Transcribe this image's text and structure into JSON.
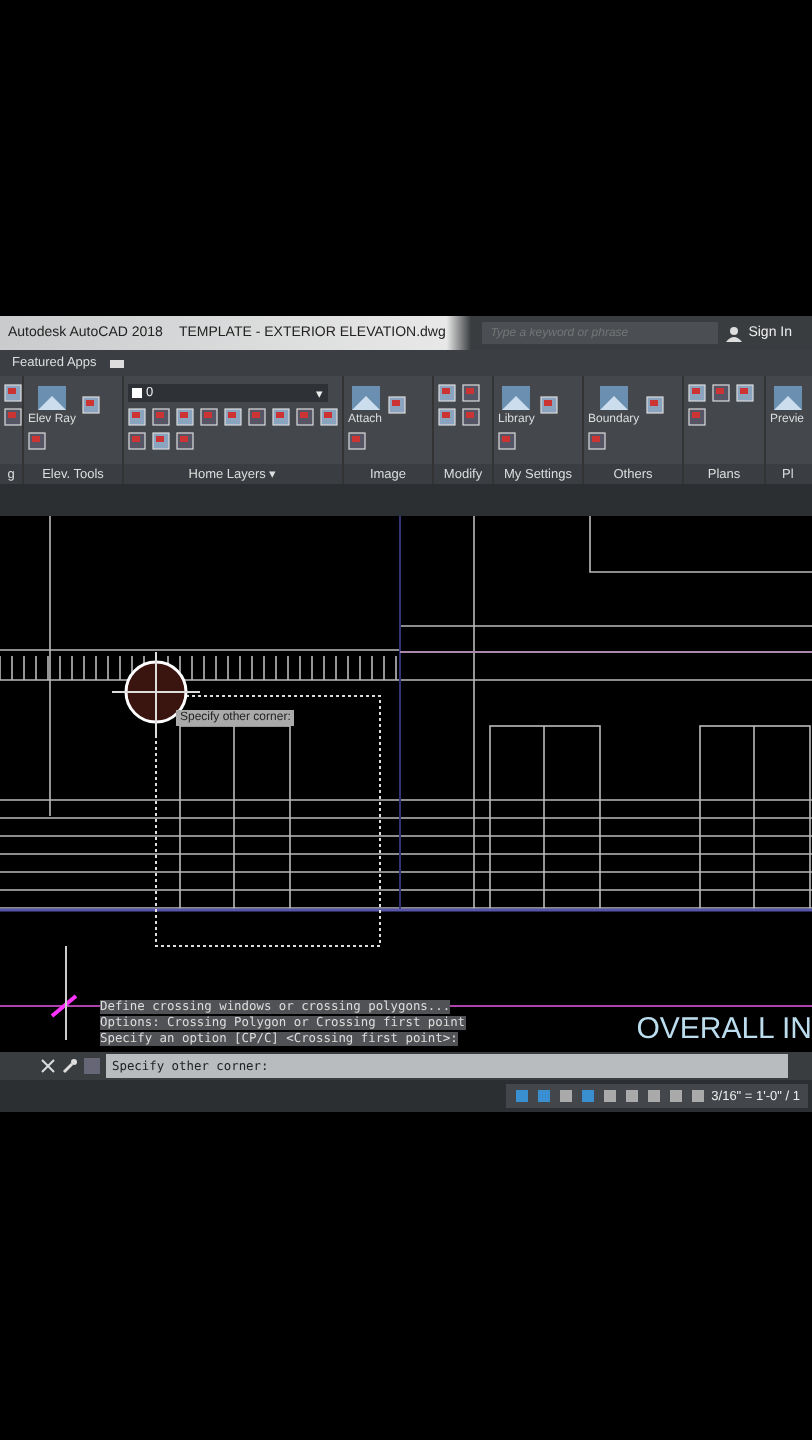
{
  "title_bar": {
    "app": "Autodesk AutoCAD 2018",
    "file": "TEMPLATE - EXTERIOR ELEVATION.dwg",
    "search": {
      "placeholder": "Type a keyword or phrase"
    },
    "sign_in": "Sign In"
  },
  "ribbon_tabs": [
    {
      "label": "Featured Apps",
      "selected": false
    }
  ],
  "ribbon": {
    "layer_value": "0",
    "layer_caret": "▾",
    "panels": [
      {
        "label": "g"
      },
      {
        "label": "Elev. Tools",
        "button": "Elev Ray"
      },
      {
        "label": "Home Layers ▾"
      },
      {
        "label": "Image",
        "button": "Attach"
      },
      {
        "label": "Modify"
      },
      {
        "label": "My Settings",
        "button": "Library"
      },
      {
        "label": "Others",
        "button": "Boundary"
      },
      {
        "label": "Plans"
      },
      {
        "label": "Pl",
        "button": "Previe"
      }
    ]
  },
  "drawing": {
    "tooltip": "Specify other corner:",
    "title_text": "OVERALL IN"
  },
  "command_history": [
    "Define crossing windows or crossing polygons...",
    "Options: Crossing Polygon or Crossing first point",
    "Specify an option [CP/C] <Crossing first point>:"
  ],
  "command_line": {
    "value": "Specify other corner:"
  },
  "status_bar": {
    "scale": "3/16\" = 1'-0\" / 1"
  }
}
